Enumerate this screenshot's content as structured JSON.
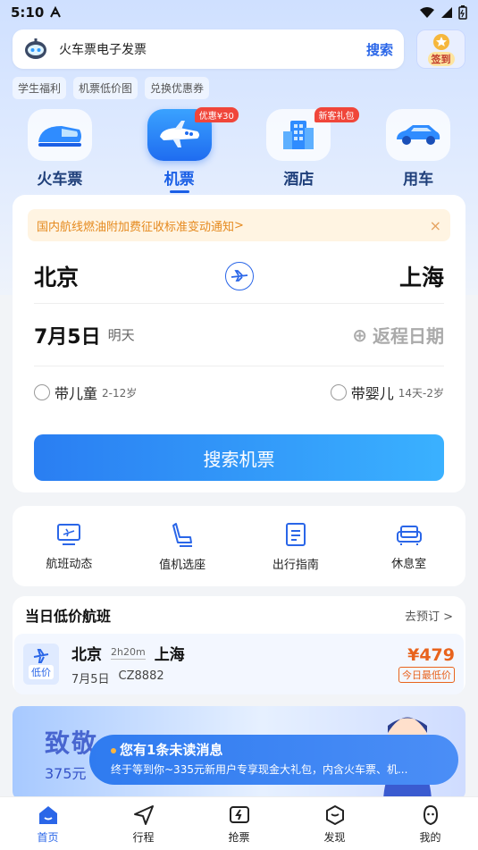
{
  "status_bar": {
    "time": "5:10"
  },
  "search": {
    "text": "火车票电子发票",
    "button": "搜索"
  },
  "signin": {
    "label": "签到"
  },
  "chips": [
    "学生福利",
    "机票低价图",
    "兑换优惠券"
  ],
  "businesses": [
    {
      "name": "火车票",
      "icon": "train-icon",
      "badge": ""
    },
    {
      "name": "机票",
      "icon": "plane-icon",
      "badge": "优惠¥30",
      "active": true
    },
    {
      "name": "酒店",
      "icon": "hotel-icon",
      "badge": "新客礼包"
    },
    {
      "name": "用车",
      "icon": "car-icon",
      "badge": ""
    }
  ],
  "notice": {
    "text": "国内航线燃油附加费征收标准变动通知",
    "arrow": ">",
    "close": "×"
  },
  "route": {
    "from": "北京",
    "to": "上海"
  },
  "date": {
    "main": "7月5日",
    "sub": "明天",
    "return": "返程日期",
    "return_icon": "⊕"
  },
  "passengers": {
    "child": {
      "label": "带儿童",
      "sub": "2-12岁"
    },
    "infant": {
      "label": "带婴儿",
      "sub": "14天-2岁"
    }
  },
  "search_flight_button": "搜索机票",
  "tools": [
    {
      "name": "航班动态",
      "icon": "flight-status-icon"
    },
    {
      "name": "值机选座",
      "icon": "seat-icon"
    },
    {
      "name": "出行指南",
      "icon": "guide-icon"
    },
    {
      "name": "休息室",
      "icon": "lounge-icon"
    }
  ],
  "low_fare": {
    "title": "当日低价航班",
    "more": "去预订",
    "more_arrow": ">",
    "flight": {
      "tag": "低价",
      "from": "北京",
      "duration": "2h20m",
      "to": "上海",
      "date": "7月5日",
      "number": "CZ8882",
      "price": "¥479",
      "price_tag": "今日最低价"
    }
  },
  "banner": {
    "title": "致敬",
    "sub": "375元"
  },
  "toast": {
    "title": "您有1条未读消息",
    "body": "终于等到你~335元新用户专享现金大礼包，内含火车票、机..."
  },
  "tabs": [
    {
      "label": "首页",
      "icon": "home-icon",
      "active": true
    },
    {
      "label": "行程",
      "icon": "trip-icon"
    },
    {
      "label": "抢票",
      "icon": "grab-ticket-icon"
    },
    {
      "label": "发现",
      "icon": "discover-icon"
    },
    {
      "label": "我的",
      "icon": "profile-icon"
    }
  ],
  "colors": {
    "accent": "#2a66e8",
    "price": "#e8631d",
    "notice": "#e58a1f"
  }
}
